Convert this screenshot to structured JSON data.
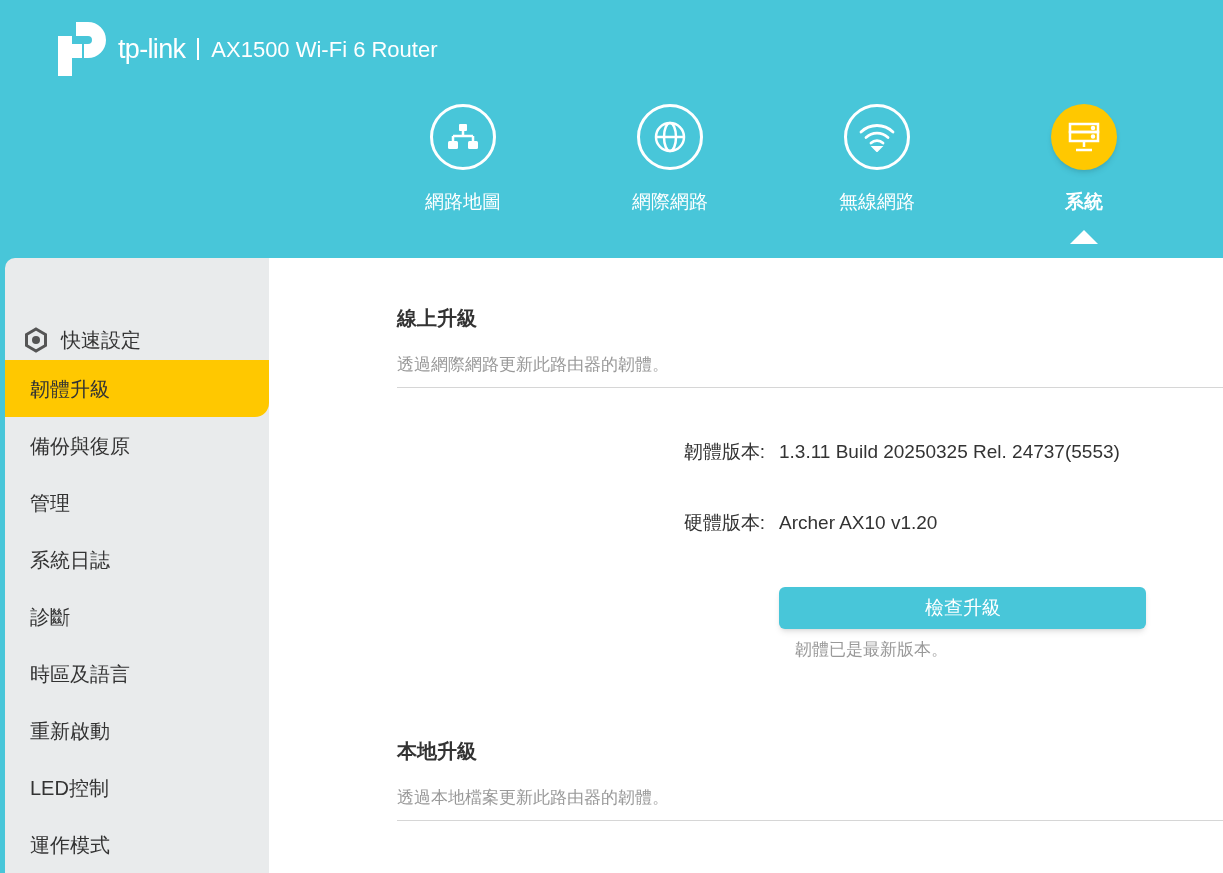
{
  "header": {
    "brand": "tp-link",
    "model": "AX1500 Wi-Fi 6 Router"
  },
  "nav_tabs": [
    {
      "kind": "network_map",
      "label": "網路地圖",
      "selected": false
    },
    {
      "kind": "internet",
      "label": "網際網路",
      "selected": false
    },
    {
      "kind": "wireless",
      "label": "無線網路",
      "selected": false
    },
    {
      "kind": "system",
      "label": "系統",
      "selected": true
    }
  ],
  "sidebar": {
    "items": [
      {
        "kind": "setup",
        "label": "快速設定",
        "selected": false
      },
      {
        "kind": "plain",
        "label": "韌體升級",
        "selected": true
      },
      {
        "kind": "plain",
        "label": "備份與復原",
        "selected": false
      },
      {
        "kind": "plain",
        "label": "管理",
        "selected": false
      },
      {
        "kind": "plain",
        "label": "系統日誌",
        "selected": false
      },
      {
        "kind": "plain",
        "label": "診斷",
        "selected": false
      },
      {
        "kind": "plain",
        "label": "時區及語言",
        "selected": false
      },
      {
        "kind": "plain",
        "label": "重新啟動",
        "selected": false
      },
      {
        "kind": "plain",
        "label": "LED控制",
        "selected": false
      },
      {
        "kind": "plain",
        "label": "運作模式",
        "selected": false
      }
    ]
  },
  "online_upgrade": {
    "title": "線上升級",
    "description": "透過網際網路更新此路由器的韌體。",
    "fields": [
      {
        "label": "韌體版本:",
        "value": "1.3.11 Build 20250325 Rel. 24737(5553)"
      },
      {
        "label": "硬體版本:",
        "value": "Archer AX10 v1.20"
      }
    ],
    "button": "檢查升級",
    "status": "韌體已是最新版本。"
  },
  "local_upgrade": {
    "title": "本地升級",
    "description": "透過本地檔案更新此路由器的韌體。"
  }
}
